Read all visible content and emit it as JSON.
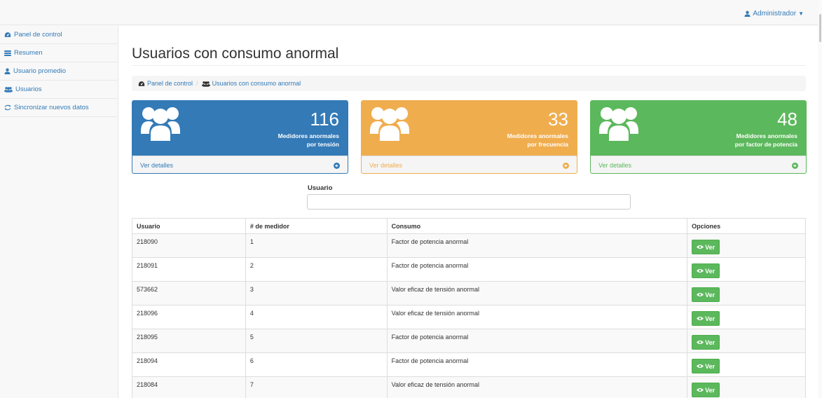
{
  "topbar": {
    "user": "Administrador"
  },
  "sidebar": {
    "items": [
      {
        "label": "Panel de control"
      },
      {
        "label": "Resumen"
      },
      {
        "label": "Usuario promedio"
      },
      {
        "label": "Usuarios"
      },
      {
        "label": "Sincronizar nuevos datos"
      }
    ]
  },
  "page": {
    "title": "Usuarios con consumo anormal"
  },
  "breadcrumb": {
    "home": "Panel de control",
    "separator": "/",
    "current": "Usuarios con consumo anormal"
  },
  "panels": [
    {
      "count": "116",
      "label_line1": "Medidores anormales",
      "label_line2": "por tensión",
      "link": "Ver detalles",
      "color": "#337ab7"
    },
    {
      "count": "33",
      "label_line1": "Medidores anormales",
      "label_line2": "por frecuencia",
      "link": "Ver detalles",
      "color": "#f0ad4e"
    },
    {
      "count": "48",
      "label_line1": "Medidores anormales",
      "label_line2": "por factor de potencia",
      "link": "Ver detalles",
      "color": "#5cb85c"
    }
  ],
  "search": {
    "label": "Usuario",
    "value": "",
    "placeholder": ""
  },
  "table": {
    "headers": [
      "Usuario",
      "# de medidor",
      "Consumo",
      "Opciones"
    ],
    "button_label": "Ver",
    "rows": [
      {
        "usuario": "218090",
        "medidor": "1",
        "consumo": "Factor de potencia anormal"
      },
      {
        "usuario": "218091",
        "medidor": "2",
        "consumo": "Factor de potencia anormal"
      },
      {
        "usuario": "573662",
        "medidor": "3",
        "consumo": "Valor eficaz de tensión anormal"
      },
      {
        "usuario": "218096",
        "medidor": "4",
        "consumo": "Valor eficaz de tensión anormal"
      },
      {
        "usuario": "218095",
        "medidor": "5",
        "consumo": "Factor de potencia anormal"
      },
      {
        "usuario": "218094",
        "medidor": "6",
        "consumo": "Factor de potencia anormal"
      },
      {
        "usuario": "218084",
        "medidor": "7",
        "consumo": "Valor eficaz de tensión anormal"
      }
    ]
  },
  "icons": {
    "sidebar": [
      "dashboard-icon",
      "list-icon",
      "user-icon",
      "users-icon",
      "refresh-icon"
    ],
    "panel": "users-icon",
    "panel_footer": "arrow-circle-right-icon",
    "button": "eye-icon",
    "topbar": "user-icon"
  },
  "colors": {
    "primary": "#337ab7",
    "warning": "#f0ad4e",
    "success": "#5cb85c"
  }
}
